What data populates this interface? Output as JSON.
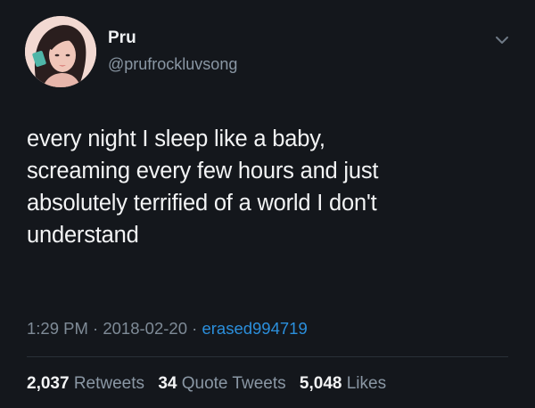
{
  "tweet": {
    "author": {
      "display_name": "Pru",
      "handle": "@prufrockluvsong"
    },
    "text_lines": [
      "every night I sleep like a baby,",
      "screaming every few hours and just",
      "absolutely terrified of a world I don't",
      "understand"
    ],
    "time": "1:29 PM",
    "separator": "·",
    "date": "2018-02-20",
    "via": "erased994719",
    "stats": {
      "retweets": {
        "count": "2,037",
        "label": "Retweets"
      },
      "quote_tweets": {
        "count": "34",
        "label": "Quote Tweets"
      },
      "likes": {
        "count": "5,048",
        "label": "Likes"
      }
    }
  },
  "icons": {
    "avatar": "profile-photo",
    "menu": "chevron-down-icon"
  },
  "colors": {
    "background": "#14171c",
    "text": "#f3f4f5",
    "secondary": "#8a97a4",
    "link": "#2b8fdc",
    "divider": "#2a3038"
  }
}
